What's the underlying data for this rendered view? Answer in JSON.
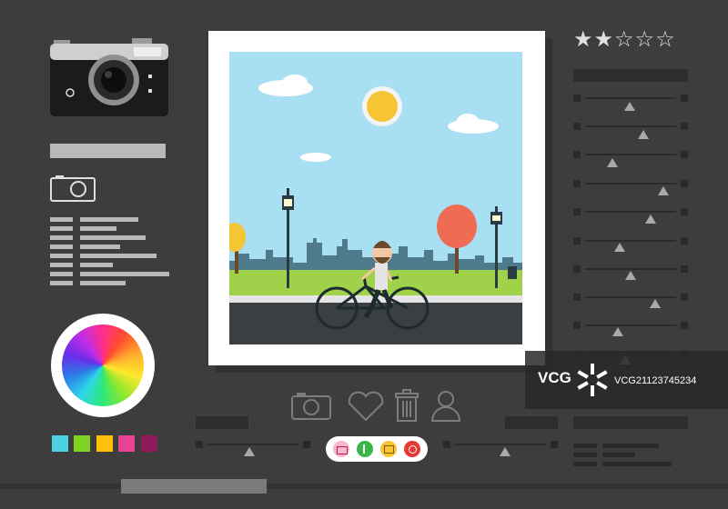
{
  "rating": {
    "stars": [
      "★",
      "★",
      "☆",
      "☆",
      "☆"
    ],
    "filled": 2,
    "max": 5
  },
  "swatches": [
    "#4dd0e1",
    "#7ed321",
    "#ffc107",
    "#e84393",
    "#8e1a5a"
  ],
  "toolbar": {
    "icons": [
      "camera-icon",
      "heart-icon",
      "trash-icon",
      "user-icon"
    ]
  },
  "quick_actions": [
    "camera-action",
    "flag-action",
    "photo-action",
    "video-action"
  ],
  "watermark": {
    "logo": "VCG",
    "id": "VCG21123745234"
  }
}
